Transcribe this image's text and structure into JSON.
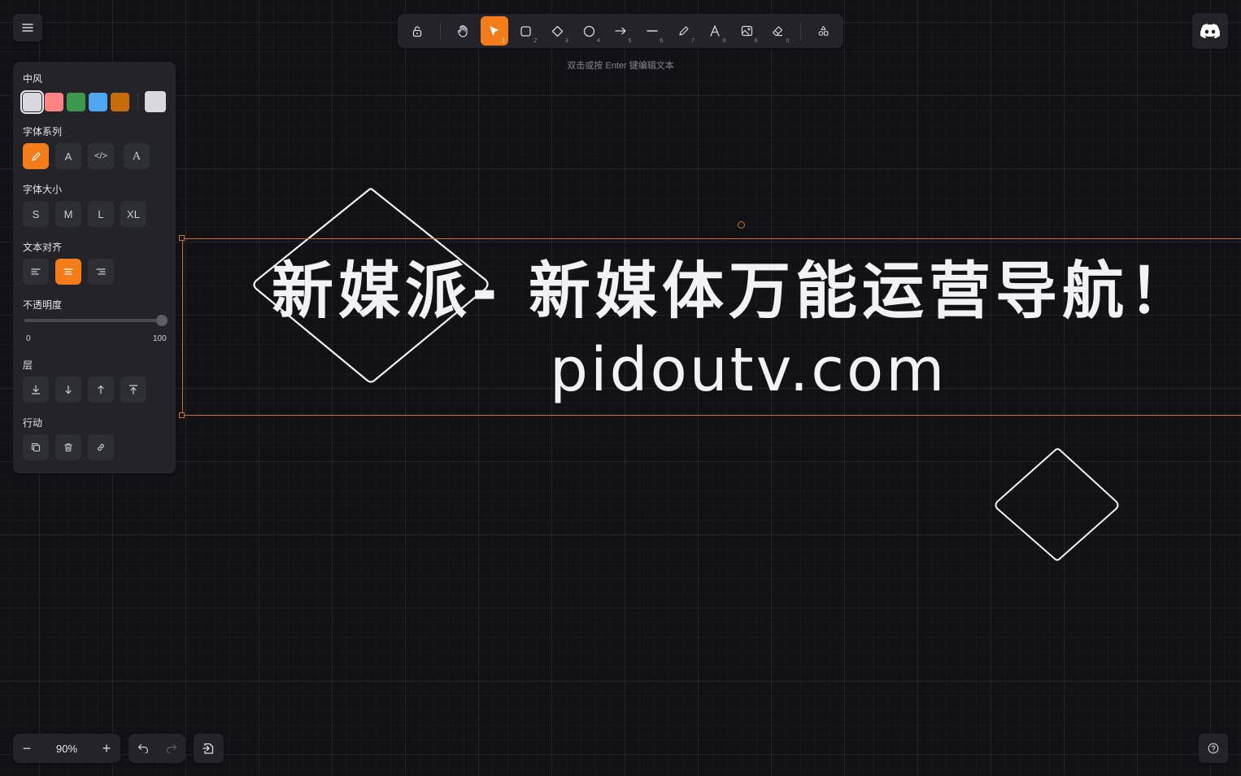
{
  "menu": {
    "icon": "hamburger-menu-icon"
  },
  "toolbar": {
    "tools": [
      {
        "name": "lock-icon",
        "shortcut": ""
      },
      {
        "name": "hand-icon",
        "shortcut": ""
      },
      {
        "name": "selection-pointer-icon",
        "shortcut": "1",
        "active": true
      },
      {
        "name": "rectangle-icon",
        "shortcut": "2"
      },
      {
        "name": "diamond-icon",
        "shortcut": "3"
      },
      {
        "name": "ellipse-icon",
        "shortcut": "4"
      },
      {
        "name": "arrow-icon",
        "shortcut": "5"
      },
      {
        "name": "line-icon",
        "shortcut": "6"
      },
      {
        "name": "pencil-draw-icon",
        "shortcut": "7"
      },
      {
        "name": "text-icon",
        "shortcut": "8"
      },
      {
        "name": "image-icon",
        "shortcut": "9"
      },
      {
        "name": "eraser-icon",
        "shortcut": "0"
      },
      {
        "name": "library-shapes-icon",
        "shortcut": ""
      }
    ]
  },
  "hint": "双击或按 Enter 键编辑文本",
  "discord": {
    "icon": "discord-icon"
  },
  "panel": {
    "stroke_label": "中风",
    "stroke_colors": [
      "#d9d9de",
      "#ff8383",
      "#3a994c",
      "#4da6ef",
      "#c86b0a"
    ],
    "stroke_current": "#d9d9de",
    "font_family_label": "字体系列",
    "font_family_active": "hand-drawn",
    "font_size_label": "字体大小",
    "font_sizes": [
      "S",
      "M",
      "L",
      "XL"
    ],
    "font_family_glyphs": {
      "normal": "A",
      "code": "</>",
      "heading": "A"
    },
    "text_align_label": "文本对齐",
    "text_align_active": "center",
    "opacity_label": "不透明度",
    "opacity_min": "0",
    "opacity_max": "100",
    "opacity_value": 100,
    "layers_label": "层",
    "actions_label": "行动"
  },
  "canvas": {
    "text_line1": "新媒派- 新媒体万能运营导航！",
    "text_line2": "pidoutv.com",
    "text_color": "#f2f2f4",
    "selection_color": "#c7732a"
  },
  "bottom": {
    "zoom": "90%",
    "zoom_out": "−",
    "zoom_in": "+",
    "undo": "↶",
    "redo": "↷"
  },
  "colors": {
    "accent": "#f57c1a",
    "background": "#121116",
    "panel": "#232329"
  }
}
